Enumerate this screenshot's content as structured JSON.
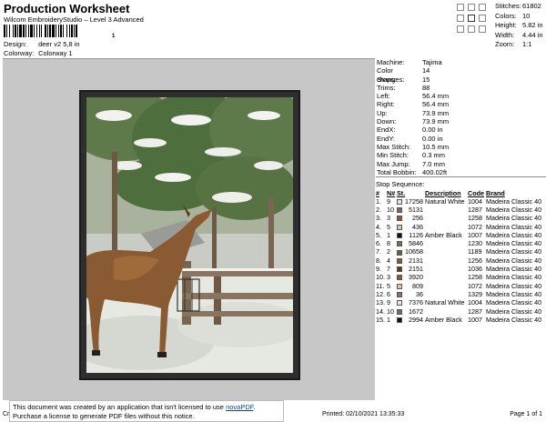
{
  "header": {
    "title": "Production Worksheet",
    "software": "Wilcom EmbroideryStudio – Level 3 Advanced",
    "barcode_suffix": "1",
    "design_label": "Design:",
    "design_value": "deer v2 5,8 in",
    "colorway_label": "Colorway:",
    "colorway_value": "Colorway 1"
  },
  "summary": [
    {
      "label": "Stitches:",
      "value": "61802"
    },
    {
      "label": "Colors:",
      "value": "10"
    },
    {
      "label": "Height:",
      "value": "5.82 in"
    },
    {
      "label": "Width:",
      "value": "4.44 in"
    },
    {
      "label": "Zoom:",
      "value": "1:1"
    }
  ],
  "machine_info": [
    {
      "label": "Machine:",
      "value": "Tajima"
    },
    {
      "label": "Color changes:",
      "value": "14"
    },
    {
      "label": "Stops:",
      "value": "15"
    },
    {
      "label": "Trims:",
      "value": "88"
    },
    {
      "label": "Left:",
      "value": "56.4 mm"
    },
    {
      "label": "Right:",
      "value": "56.4 mm"
    },
    {
      "label": "Up:",
      "value": "73.9 mm"
    },
    {
      "label": "Down:",
      "value": "73.9 mm"
    },
    {
      "label": "EndX:",
      "value": "0.00 in"
    },
    {
      "label": "EndY:",
      "value": "0.00 in"
    },
    {
      "label": "Max Stitch:",
      "value": "10.5 mm"
    },
    {
      "label": "Min Stitch:",
      "value": "0.3 mm"
    },
    {
      "label": "Max Jump:",
      "value": "7.0 mm"
    },
    {
      "label": "Total Bobbin:",
      "value": "400.02ft"
    }
  ],
  "stop_sequence": {
    "heading": "Stop Sequence:",
    "columns": [
      "#",
      "N#",
      "St.",
      "Description",
      "Code",
      "Brand"
    ],
    "rows": [
      {
        "n": "1.",
        "nn": "9",
        "color": "#e8e4dc",
        "st": "17258",
        "desc": "Natural White",
        "code": "1004",
        "brand": "Madeira Classic 40"
      },
      {
        "n": "2.",
        "nn": "10",
        "color": "#6e6e6e",
        "st": "5131",
        "desc": "",
        "code": "1287",
        "brand": "Madeira Classic 40"
      },
      {
        "n": "3.",
        "nn": "3",
        "color": "#a0522d",
        "st": "256",
        "desc": "",
        "code": "1258",
        "brand": "Madeira Classic 40"
      },
      {
        "n": "4.",
        "nn": "5",
        "color": "#d8c8b0",
        "st": "436",
        "desc": "",
        "code": "1072",
        "brand": "Madeira Classic 40"
      },
      {
        "n": "5.",
        "nn": "1",
        "color": "#111111",
        "st": "1126",
        "desc": "Amber Black",
        "code": "1007",
        "brand": "Madeira Classic 40"
      },
      {
        "n": "6.",
        "nn": "8",
        "color": "#7a6e60",
        "st": "5846",
        "desc": "",
        "code": "1230",
        "brand": "Madeira Classic 40"
      },
      {
        "n": "7.",
        "nn": "2",
        "color": "#4f6e3e",
        "st": "10658",
        "desc": "",
        "code": "1189",
        "brand": "Madeira Classic 40"
      },
      {
        "n": "8.",
        "nn": "4",
        "color": "#8a5a32",
        "st": "2131",
        "desc": "",
        "code": "1256",
        "brand": "Madeira Classic 40"
      },
      {
        "n": "9.",
        "nn": "7",
        "color": "#5a3a20",
        "st": "2151",
        "desc": "",
        "code": "1036",
        "brand": "Madeira Classic 40"
      },
      {
        "n": "10.",
        "nn": "3",
        "color": "#a0522d",
        "st": "3920",
        "desc": "",
        "code": "1258",
        "brand": "Madeira Classic 40"
      },
      {
        "n": "11.",
        "nn": "5",
        "color": "#d8c8b0",
        "st": "809",
        "desc": "",
        "code": "1072",
        "brand": "Madeira Classic 40"
      },
      {
        "n": "12.",
        "nn": "6",
        "color": "#9a6a6a",
        "st": "36",
        "desc": "",
        "code": "1329",
        "brand": "Madeira Classic 40"
      },
      {
        "n": "13.",
        "nn": "9",
        "color": "#e8e4dc",
        "st": "7376",
        "desc": "Natural White",
        "code": "1004",
        "brand": "Madeira Classic 40"
      },
      {
        "n": "14.",
        "nn": "10",
        "color": "#6e6e6e",
        "st": "1672",
        "desc": "",
        "code": "1287",
        "brand": "Madeira Classic 40"
      },
      {
        "n": "15.",
        "nn": "1",
        "color": "#111111",
        "st": "2994",
        "desc": "Amber Black",
        "code": "1007",
        "brand": "Madeira Classic 40"
      }
    ]
  },
  "footer": {
    "cr": "Cr",
    "nova_line1_pre": "This document was created by an application that isn't licensed to use ",
    "nova_link": "novaPDF",
    "nova_line1_post": ".",
    "nova_line2": "Purchase a license to generate PDF files without this notice.",
    "printed": "Printed: 02/10/2021 13:35:33",
    "page": "Page 1 of 1"
  }
}
